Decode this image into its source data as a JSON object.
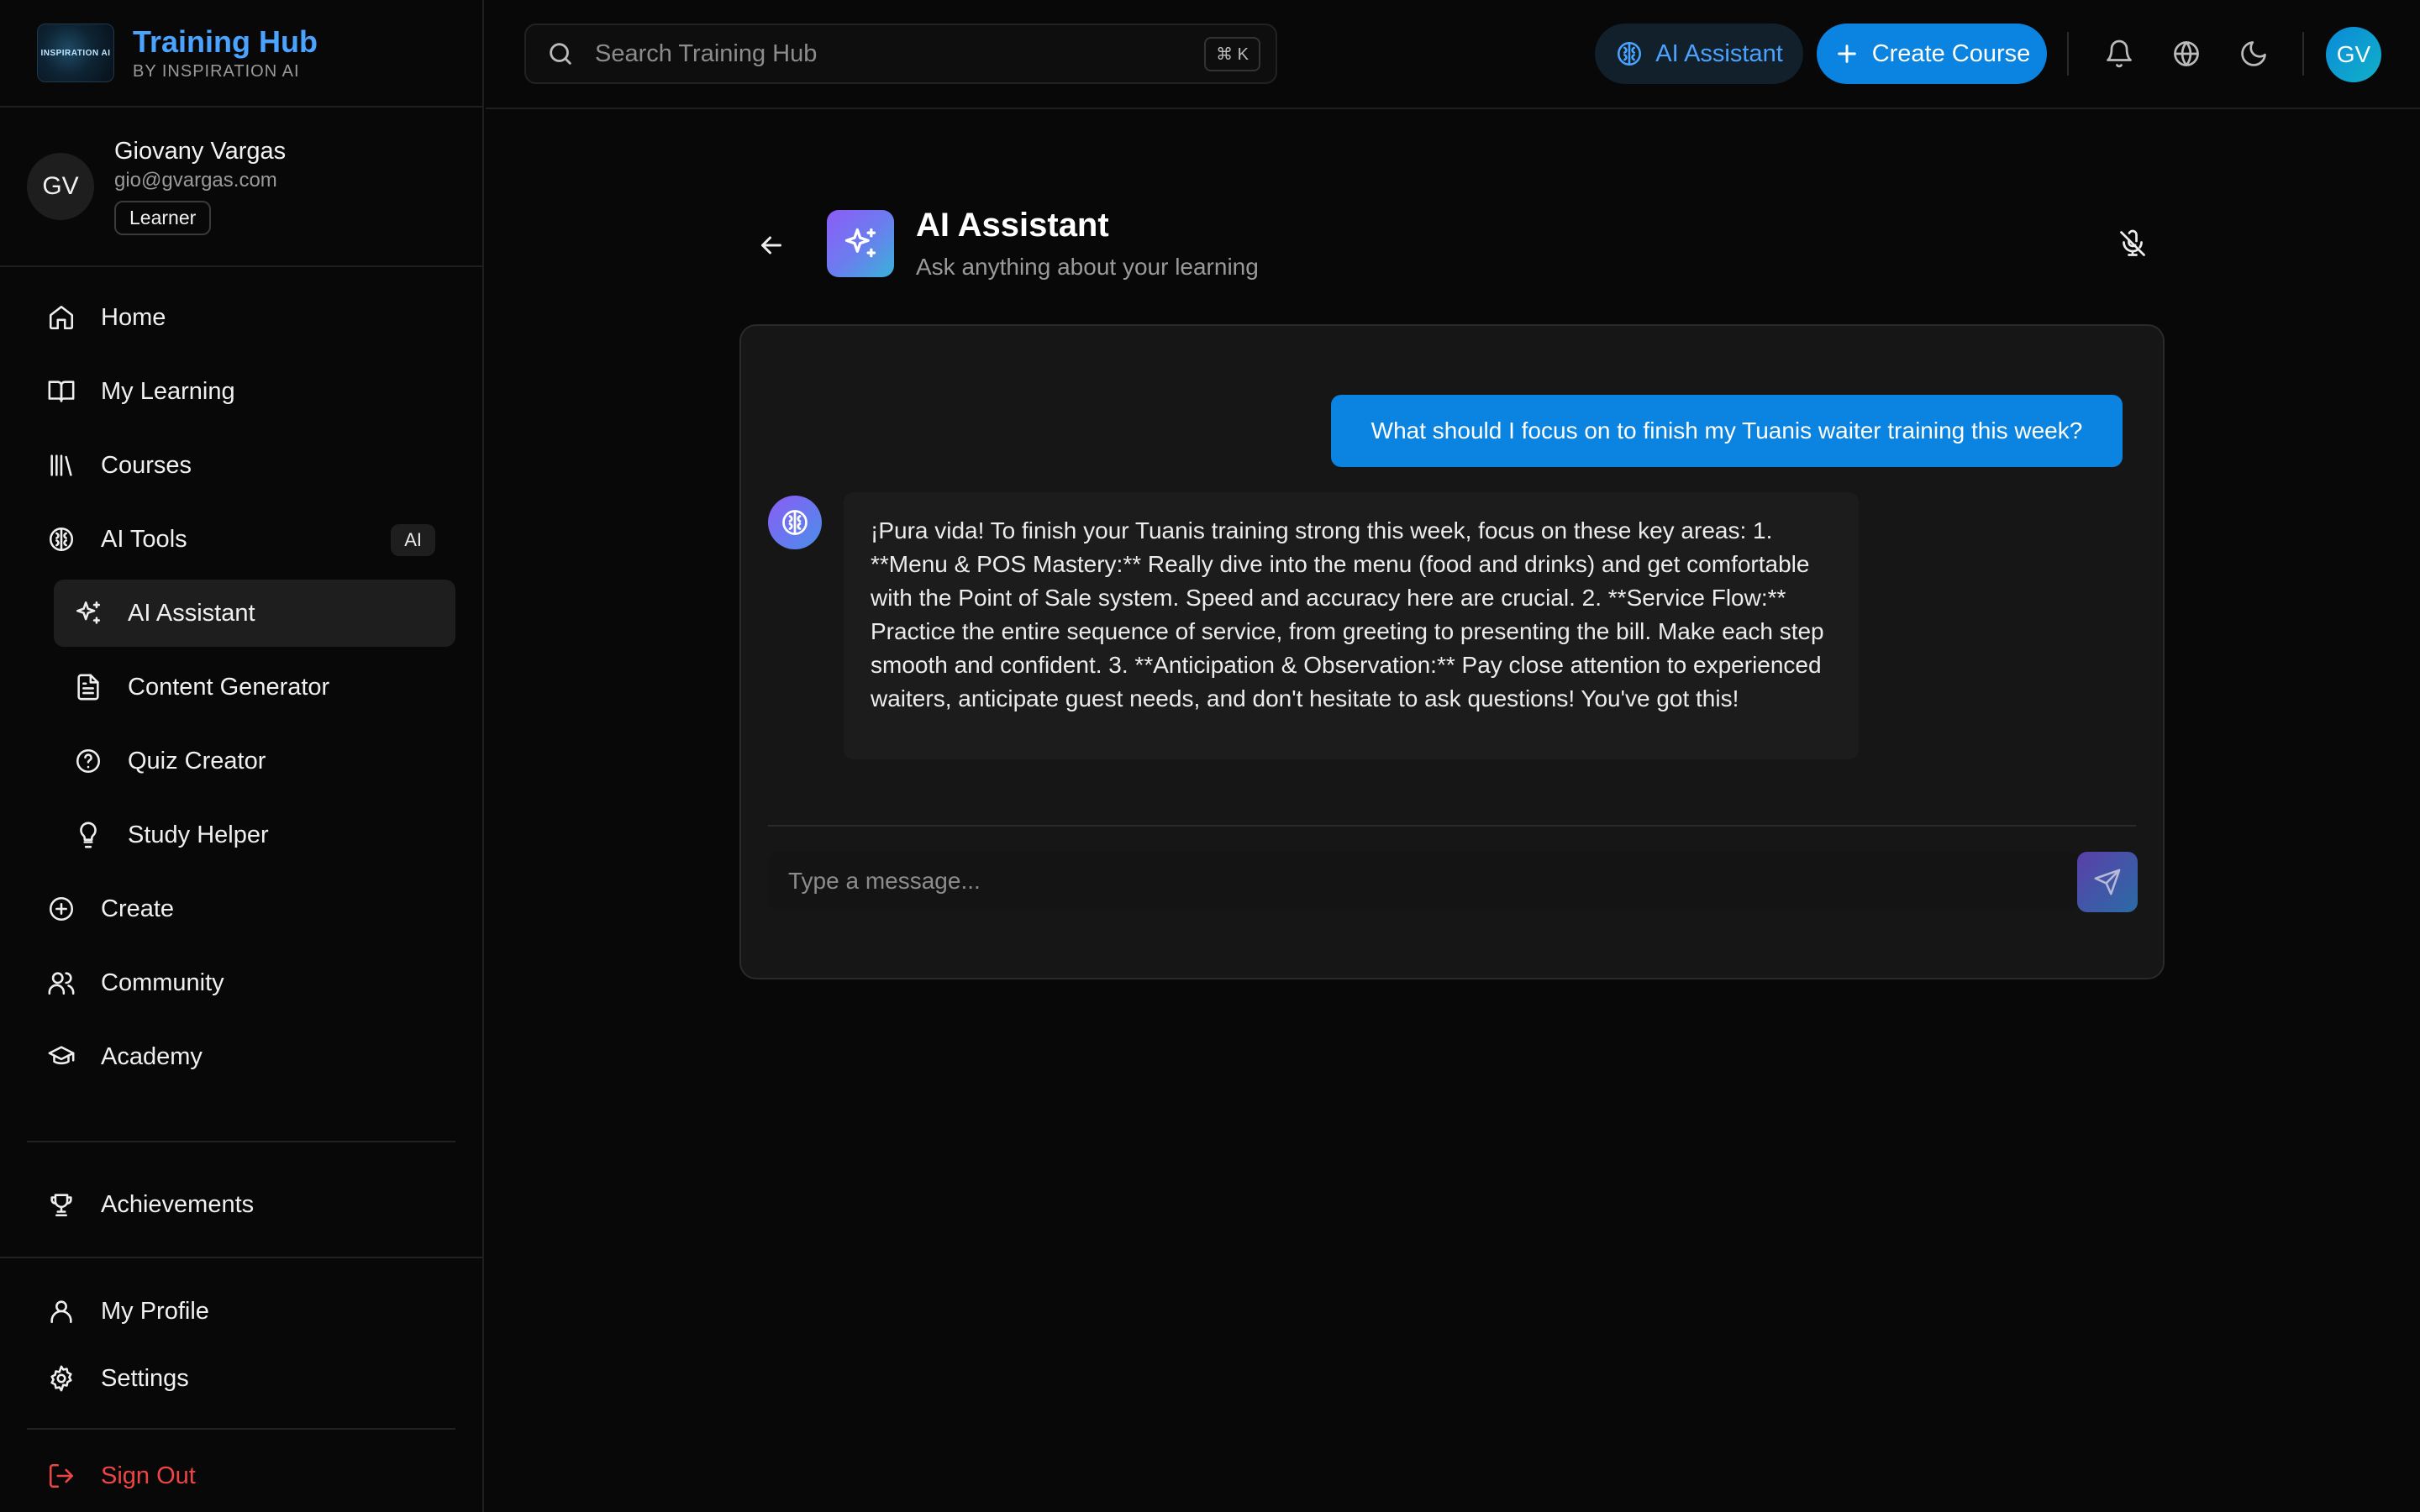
{
  "brand": {
    "title": "Training Hub",
    "subtitle": "BY INSPIRATION AI",
    "logo_text": "INSPIRATION AI"
  },
  "profile": {
    "initials": "GV",
    "name": "Giovany Vargas",
    "email": "gio@gvargas.com",
    "role": "Learner"
  },
  "sidebar": {
    "items": [
      {
        "label": "Home",
        "icon": "home-icon"
      },
      {
        "label": "My Learning",
        "icon": "book-open-icon"
      },
      {
        "label": "Courses",
        "icon": "library-icon"
      },
      {
        "label": "AI Tools",
        "icon": "brain-icon",
        "badge": "AI"
      },
      {
        "label": "AI Assistant",
        "icon": "sparkles-icon",
        "active": true
      },
      {
        "label": "Content Generator",
        "icon": "file-text-icon"
      },
      {
        "label": "Quiz Creator",
        "icon": "help-circle-icon"
      },
      {
        "label": "Study Helper",
        "icon": "lightbulb-icon"
      },
      {
        "label": "Create",
        "icon": "plus-circle-icon"
      },
      {
        "label": "Community",
        "icon": "users-icon"
      },
      {
        "label": "Academy",
        "icon": "graduation-cap-icon"
      }
    ],
    "achievements": "Achievements",
    "my_profile": "My Profile",
    "settings": "Settings",
    "sign_out": "Sign Out"
  },
  "topbar": {
    "search_placeholder": "Search Training Hub",
    "shortcut": "⌘ K",
    "ai_button": "AI Assistant",
    "create_button": "Create Course",
    "avatar_initials": "GV"
  },
  "page": {
    "title": "AI Assistant",
    "subtitle": "Ask anything about your learning"
  },
  "chat": {
    "user_message": "What should I focus on to finish my Tuanis waiter training this week?",
    "assistant_message": "¡Pura vida! To finish your Tuanis training strong this week, focus on these key areas: 1. **Menu & POS Mastery:** Really dive into the menu (food and drinks) and get comfortable with the Point of Sale system. Speed and accuracy here are crucial. 2. **Service Flow:** Practice the entire sequence of service, from greeting to presenting the bill. Make each step smooth and confident. 3. **Anticipation & Observation:** Pay close attention to experienced waiters, anticipate guest needs, and don't hesitate to ask questions! You've got this!",
    "input_placeholder": "Type a message..."
  },
  "colors": {
    "accent": "#0a84e0",
    "brand": "#4aa3ff",
    "danger": "#ef4444",
    "background": "#080808"
  }
}
